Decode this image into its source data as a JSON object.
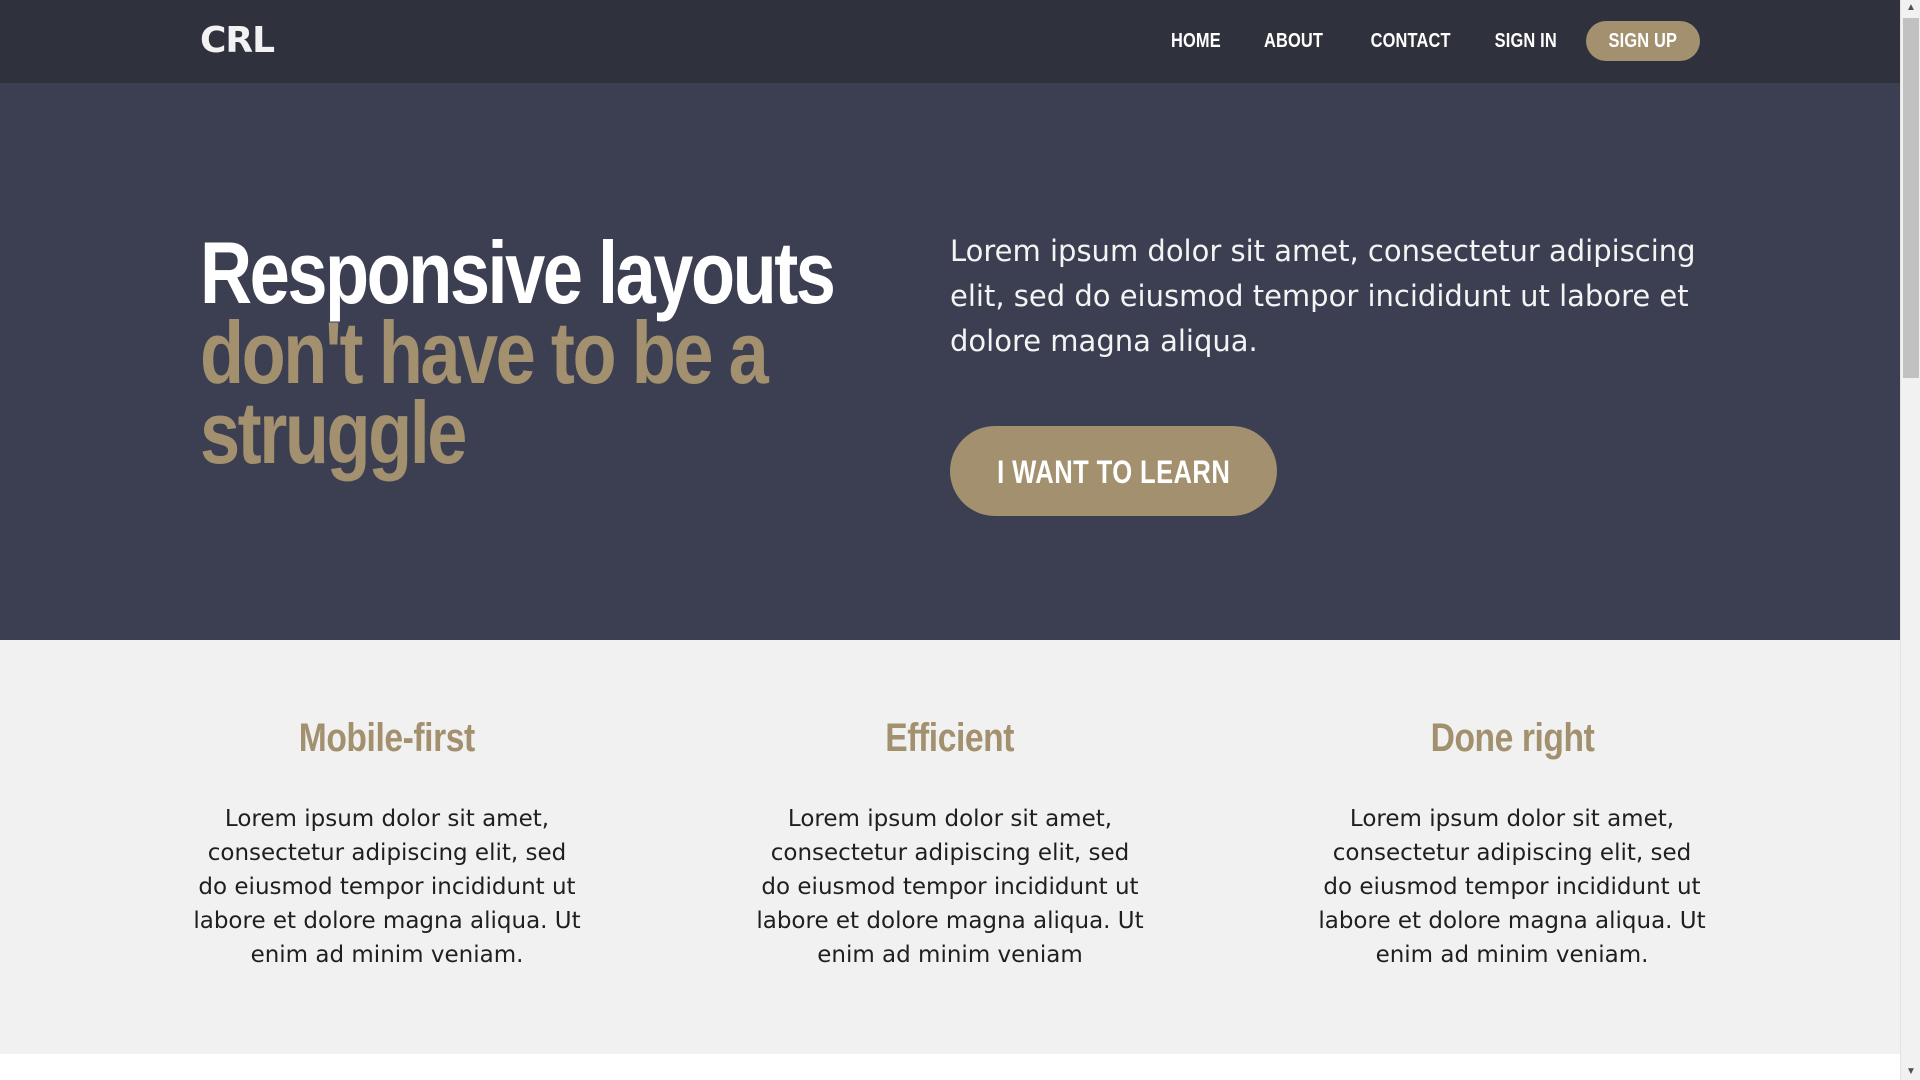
{
  "header": {
    "logo": "CRL",
    "nav": [
      "HOME",
      "ABOUT",
      "CONTACT",
      "SIGN IN"
    ],
    "signup": "SIGN UP"
  },
  "hero": {
    "title_line1": "Responsive layouts",
    "title_line2": "don't have to be a",
    "title_line3": "struggle",
    "text": "Lorem ipsum dolor sit amet, consectetur adipiscing elit, sed do eiusmod tempor incididunt ut labore et dolore magna aliqua.",
    "cta": "I WANT TO LEARN"
  },
  "features": [
    {
      "title": "Mobile-first",
      "text": "Lorem ipsum dolor sit amet, consectetur adipiscing elit, sed do eiusmod tempor incididunt ut labore et dolore magna aliqua. Ut enim ad minim veniam."
    },
    {
      "title": "Efficient",
      "text": "Lorem ipsum dolor sit amet, consectetur adipiscing elit, sed do eiusmod tempor incididunt ut labore et dolore magna aliqua. Ut enim ad minim veniam"
    },
    {
      "title": "Done right",
      "text": "Lorem ipsum dolor sit amet, consectetur adipiscing elit, sed do eiusmod tempor incididunt ut labore et dolore magna aliqua. Ut enim ad minim veniam."
    }
  ],
  "scrollbar": {
    "up_icon": "▲",
    "down_icon": "▼"
  },
  "colors": {
    "header_bg": "#2f313d",
    "hero_bg": "#3b3f51",
    "accent": "#a2906e",
    "features_bg": "#f1f1f1"
  }
}
